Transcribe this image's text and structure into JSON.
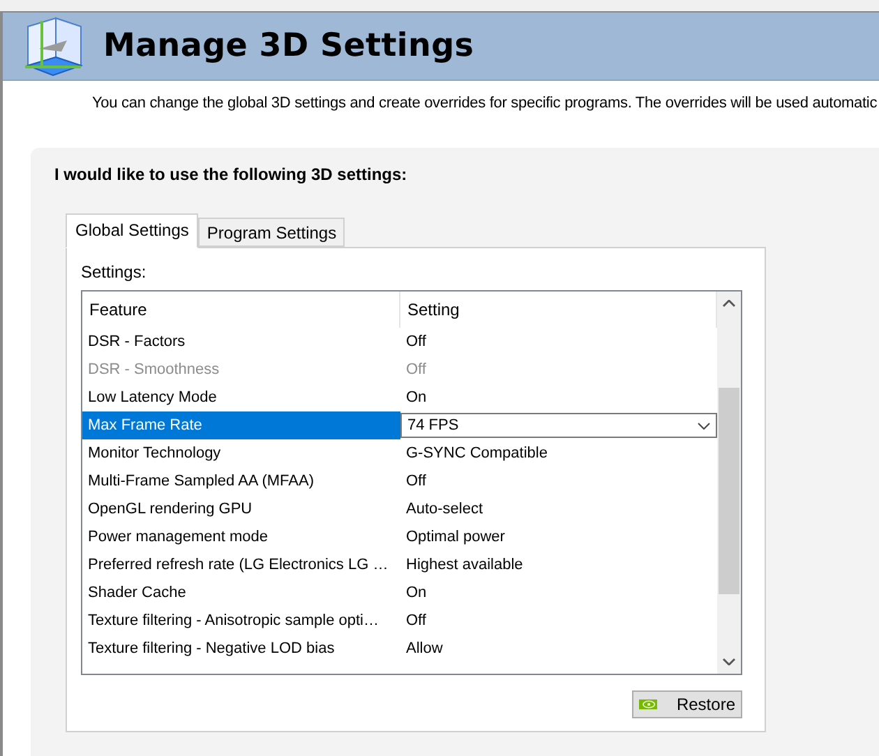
{
  "header": {
    "title": "Manage 3D Settings",
    "description": "You can change the global 3D settings and create overrides for specific programs. The overrides will be used automatic"
  },
  "panel": {
    "heading": "I would like to use the following 3D settings:",
    "tabs": [
      {
        "label": "Global Settings",
        "selected": true
      },
      {
        "label": "Program Settings",
        "selected": false
      }
    ],
    "settings_label": "Settings:",
    "table": {
      "columns": [
        "Feature",
        "Setting"
      ],
      "rows": [
        {
          "feature": "DSR - Factors",
          "setting": "Off",
          "disabled": false,
          "selected": false
        },
        {
          "feature": "DSR - Smoothness",
          "setting": "Off",
          "disabled": true,
          "selected": false
        },
        {
          "feature": "Low Latency Mode",
          "setting": "On",
          "disabled": false,
          "selected": false
        },
        {
          "feature": "Max Frame Rate",
          "setting": "74 FPS",
          "disabled": false,
          "selected": true
        },
        {
          "feature": "Monitor Technology",
          "setting": "G-SYNC Compatible",
          "disabled": false,
          "selected": false
        },
        {
          "feature": "Multi-Frame Sampled AA (MFAA)",
          "setting": "Off",
          "disabled": false,
          "selected": false
        },
        {
          "feature": "OpenGL rendering GPU",
          "setting": "Auto-select",
          "disabled": false,
          "selected": false
        },
        {
          "feature": "Power management mode",
          "setting": "Optimal power",
          "disabled": false,
          "selected": false
        },
        {
          "feature": "Preferred refresh rate (LG Electronics LG …",
          "setting": "Highest available",
          "disabled": false,
          "selected": false
        },
        {
          "feature": "Shader Cache",
          "setting": "On",
          "disabled": false,
          "selected": false
        },
        {
          "feature": "Texture filtering - Anisotropic sample opti…",
          "setting": "Off",
          "disabled": false,
          "selected": false
        },
        {
          "feature": "Texture filtering - Negative LOD bias",
          "setting": "Allow",
          "disabled": false,
          "selected": false
        }
      ]
    },
    "restore_button": "Restore"
  }
}
